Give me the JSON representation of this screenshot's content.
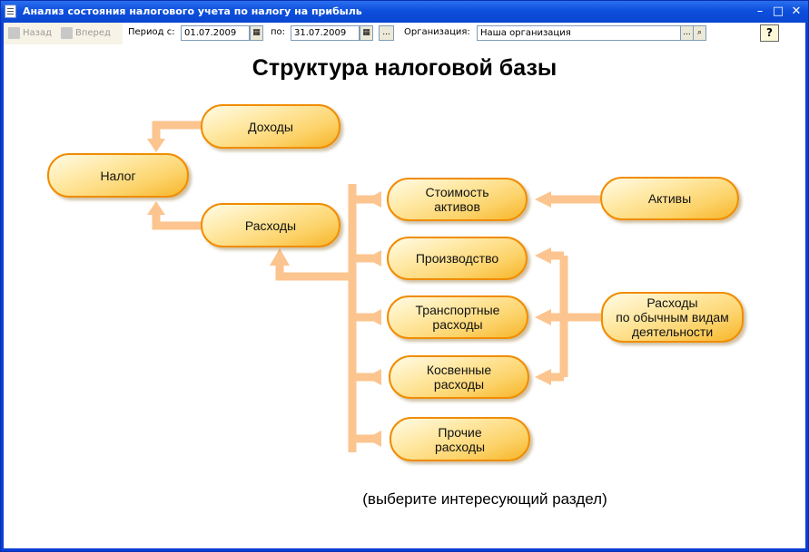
{
  "window": {
    "title": "Анализ состояния налогового учета по налогу на прибыль",
    "minimize_glyph": "–",
    "maximize_glyph": "□",
    "close_glyph": "✕"
  },
  "toolbar": {
    "back_label": "Назад",
    "forward_label": "Вперед",
    "period_from_label": "Период с:",
    "period_from_value": "01.07.2009",
    "period_to_label": "по:",
    "period_to_value": "31.07.2009",
    "ellipsis": "...",
    "organization_label": "Организация:",
    "organization_value": "Наша организация",
    "help_glyph": "?"
  },
  "diagram": {
    "title": "Структура налоговой базы",
    "nodes": {
      "income": "Доходы",
      "tax": "Налог",
      "expenses": "Расходы",
      "asset_cost": "Стоимость\nактивов",
      "assets": "Активы",
      "production": "Производство",
      "transport": "Транспортные\nрасходы",
      "ordinary": "Расходы\nпо обычным видам\nдеятельности",
      "indirect": "Косвенные\nрасходы",
      "other": "Прочие\nрасходы"
    },
    "hint": "(выберите интересующий раздел)"
  },
  "colors": {
    "titlebar": "#0d4fdc",
    "node_border": "#f08c00",
    "node_fill": "#fcd36a",
    "connector": "#fcc48e"
  }
}
